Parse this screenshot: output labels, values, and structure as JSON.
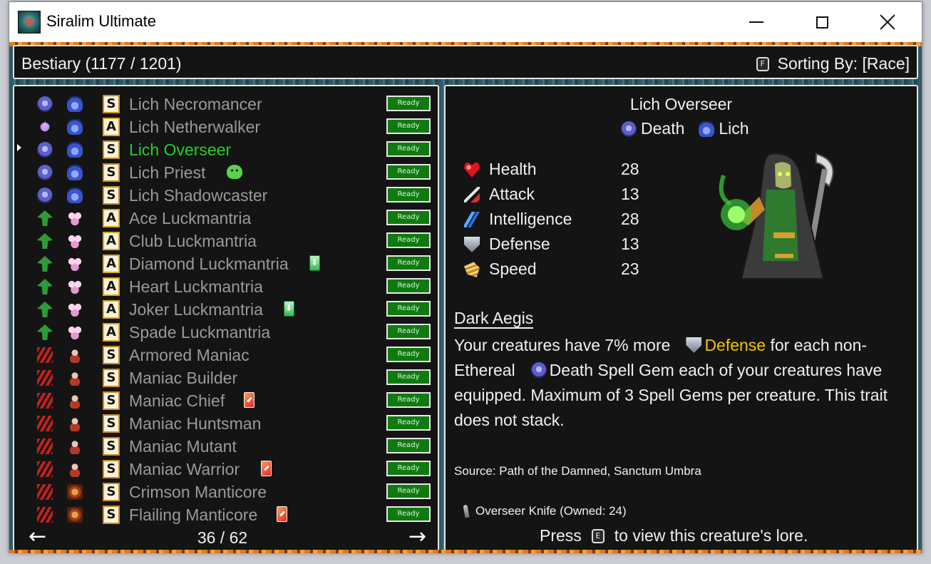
{
  "window": {
    "title": "Siralim Ultimate"
  },
  "header": {
    "title": "Bestiary (1177 / 1201)",
    "sort_key": "F",
    "sort_label": "Sorting By: [Race]"
  },
  "list": {
    "rows": [
      {
        "element": "death",
        "race": "lich",
        "class": "S",
        "name": "Lich Necromancer",
        "status": "Ready",
        "extra": null
      },
      {
        "element": "sorcery",
        "race": "lich",
        "class": "A",
        "name": "Lich Netherwalker",
        "status": "Ready",
        "extra": null
      },
      {
        "element": "death",
        "race": "lich",
        "class": "S",
        "name": "Lich Overseer",
        "status": "Ready",
        "extra": null,
        "selected": true
      },
      {
        "element": "death",
        "race": "lich",
        "class": "S",
        "name": "Lich Priest",
        "status": "Ready",
        "extra": "slime-icon"
      },
      {
        "element": "death",
        "race": "lich",
        "class": "S",
        "name": "Lich Shadowcaster",
        "status": "Ready",
        "extra": null
      },
      {
        "element": "life",
        "race": "luckmantria",
        "class": "A",
        "name": "Ace Luckmantria",
        "status": "Ready",
        "extra": null
      },
      {
        "element": "life",
        "race": "luckmantria",
        "class": "A",
        "name": "Club Luckmantria",
        "status": "Ready",
        "extra": null
      },
      {
        "element": "life",
        "race": "luckmantria",
        "class": "A",
        "name": "Diamond Luckmantria",
        "status": "Ready",
        "extra": "green-card-icon"
      },
      {
        "element": "life",
        "race": "luckmantria",
        "class": "A",
        "name": "Heart Luckmantria",
        "status": "Ready",
        "extra": null
      },
      {
        "element": "life",
        "race": "luckmantria",
        "class": "A",
        "name": "Joker Luckmantria",
        "status": "Ready",
        "extra": "green-card-icon"
      },
      {
        "element": "life",
        "race": "luckmantria",
        "class": "A",
        "name": "Spade Luckmantria",
        "status": "Ready",
        "extra": null
      },
      {
        "element": "chaos",
        "race": "maniac",
        "class": "S",
        "name": "Armored Maniac",
        "status": "Ready",
        "extra": null
      },
      {
        "element": "chaos",
        "race": "maniac",
        "class": "S",
        "name": "Maniac Builder",
        "status": "Ready",
        "extra": null
      },
      {
        "element": "chaos",
        "race": "maniac",
        "class": "S",
        "name": "Maniac Chief",
        "status": "Ready",
        "extra": "red-card-icon"
      },
      {
        "element": "chaos",
        "race": "maniac",
        "class": "S",
        "name": "Maniac Huntsman",
        "status": "Ready",
        "extra": null
      },
      {
        "element": "chaos",
        "race": "maniac",
        "class": "S",
        "name": "Maniac Mutant",
        "status": "Ready",
        "extra": null
      },
      {
        "element": "chaos",
        "race": "maniac",
        "class": "S",
        "name": "Maniac Warrior",
        "status": "Ready",
        "extra": "red-card-icon"
      },
      {
        "element": "chaos",
        "race": "manticore",
        "class": "S",
        "name": "Crimson Manticore",
        "status": "Ready",
        "extra": null
      },
      {
        "element": "chaos",
        "race": "manticore",
        "class": "S",
        "name": "Flailing Manticore",
        "status": "Ready",
        "extra": "red-card-icon"
      }
    ],
    "page": "36 / 62",
    "prev_arrow": "←",
    "next_arrow": "→"
  },
  "detail": {
    "name": "Lich Overseer",
    "element": "Death",
    "race": "Lich",
    "stats": [
      {
        "icon": "heart-icon",
        "label": "Health",
        "value": "28"
      },
      {
        "icon": "sword-icon",
        "label": "Attack",
        "value": "13"
      },
      {
        "icon": "lightning-icon",
        "label": "Intelligence",
        "value": "28"
      },
      {
        "icon": "shield-icon",
        "label": "Defense",
        "value": "13"
      },
      {
        "icon": "wing-icon",
        "label": "Speed",
        "value": "23"
      }
    ],
    "trait_name": "Dark Aegis",
    "trait_desc": {
      "part1": "Your creatures have 7% more",
      "highlight": "Defense",
      "part2": "for each non-Ethereal",
      "part3": "Death Spell Gem each of your creatures have equipped. Maximum of 3 Spell Gems per creature. This trait does not stack."
    },
    "source": "Source: Path of the Damned, Sanctum Umbra",
    "item": "Overseer Knife (Owned: 24)",
    "lore_press": "Press",
    "lore_key": "E",
    "lore_text": "to view this creature's lore."
  },
  "colors": {
    "selected_name": "#22d02a",
    "highlight": "#f2c300",
    "ready_bg": "#0f7a10"
  }
}
